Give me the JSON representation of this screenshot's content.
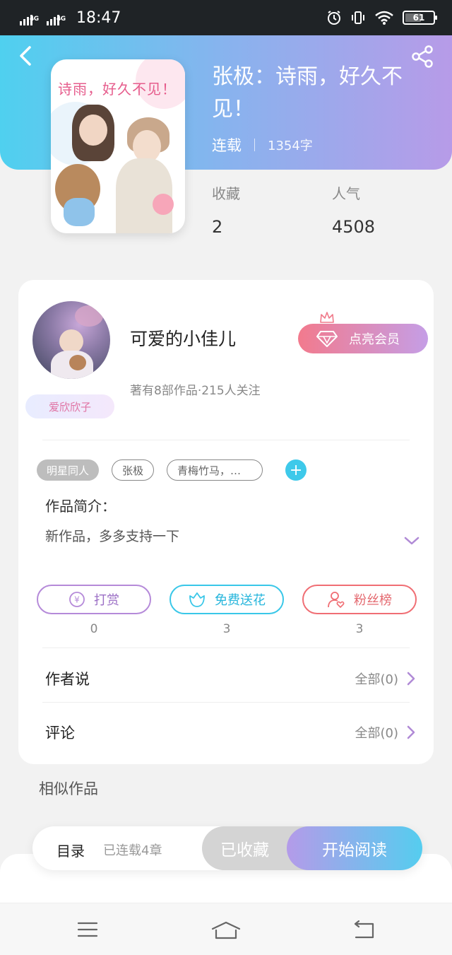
{
  "status_bar": {
    "signal1": "4G",
    "signal2": "4G",
    "time": "18:47",
    "battery": "61"
  },
  "book": {
    "title": "张极：诗雨，好久不见！",
    "status": "连载",
    "word_count": "1354字",
    "cover_text": "诗雨，好久不见！"
  },
  "stats": {
    "favorites_label": "收藏",
    "favorites_value": "2",
    "popularity_label": "人气",
    "popularity_value": "4508"
  },
  "author": {
    "name": "可爱的小佳儿",
    "sub": "著有8部作品·215人关注",
    "badge": "爱欣欣子",
    "vip_label": "点亮会员"
  },
  "tags": [
    "明星同人",
    "张极",
    "青梅竹马，…"
  ],
  "intro": {
    "label": "作品简介：",
    "text": "新作品，多多支持一下"
  },
  "actions": {
    "tip_label": "打赏",
    "tip_count": "0",
    "flower_label": "免费送花",
    "flower_count": "3",
    "fans_label": "粉丝榜",
    "fans_count": "3"
  },
  "rows": {
    "author_says_label": "作者说",
    "author_says_right": "全部(0)",
    "comments_label": "评论",
    "comments_right": "全部(0)"
  },
  "similar_label": "相似作品",
  "bottom": {
    "toc_label": "目录",
    "toc_count": "已连载4章",
    "fav_label": "已收藏",
    "read_label": "开始阅读"
  },
  "colors": {
    "accent_cyan": "#4fd0ef",
    "accent_purple": "#b79be8",
    "vip_pink": "#f27a8d"
  }
}
